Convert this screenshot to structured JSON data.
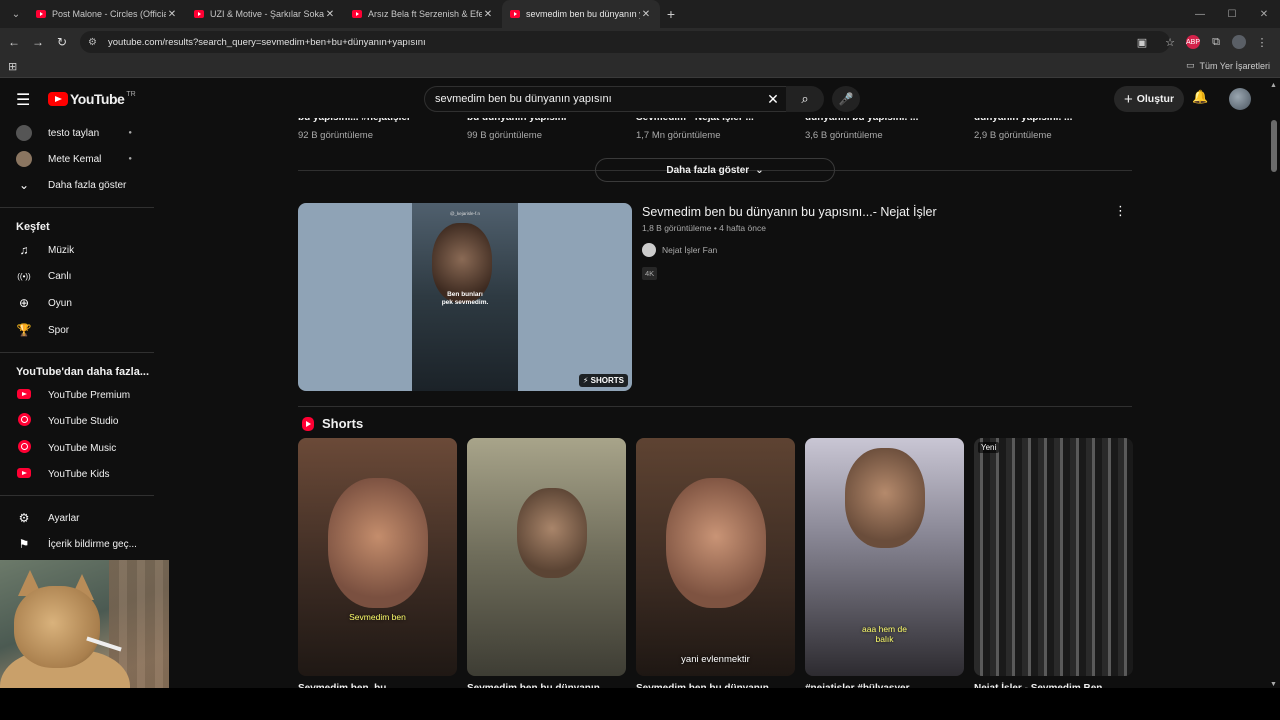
{
  "browser": {
    "tabs": [
      {
        "title": "Post Malone - Circles (Official M",
        "active": false
      },
      {
        "title": "UZI & Motive - Şarkılar Sokakla",
        "active": false
      },
      {
        "title": "Arsız Bela ft Serzenish & Efecan",
        "active": false
      },
      {
        "title": "sevmedim ben bu dünyanın ya",
        "active": true
      }
    ],
    "url": "youtube.com/results?search_query=sevmedim+ben+bu+dünyanın+yapısını",
    "bookmarks_all": "Tüm Yer İşaretleri",
    "icons": {
      "tab_close": "✕",
      "new_tab": "+",
      "back": "←",
      "forward": "→",
      "reload": "↻",
      "minimize": "—",
      "maximize": "☐",
      "close": "✕",
      "menu": "⋮",
      "star": "☆",
      "apps": "⊞",
      "folder": "▭"
    }
  },
  "header": {
    "logo_text": "YouTube",
    "country": "TR",
    "search_value": "sevmedim ben bu dünyanın yapısını",
    "create_label": "Oluştur",
    "icons": {
      "hamburger": "☰",
      "clear": "✕",
      "search": "⌕",
      "mic": "🎙",
      "plus": "+",
      "bell": "🔔"
    }
  },
  "sidebar": {
    "subscriptions": [
      {
        "label": "testo taylan"
      },
      {
        "label": "Mete Kemal"
      }
    ],
    "show_more": "Daha fazla göster",
    "explore_heading": "Keşfet",
    "explore": [
      {
        "label": "Müzik",
        "icon": "♫"
      },
      {
        "label": "Canlı",
        "icon": "((•))"
      },
      {
        "label": "Oyun",
        "icon": "🎮"
      },
      {
        "label": "Spor",
        "icon": "🏆"
      }
    ],
    "more_heading": "YouTube'dan daha fazla...",
    "more": [
      {
        "label": "YouTube Premium"
      },
      {
        "label": "YouTube Studio"
      },
      {
        "label": "YouTube Music"
      },
      {
        "label": "YouTube Kids"
      }
    ],
    "settings": [
      {
        "label": "Ayarlar",
        "icon": "⚙"
      },
      {
        "label": "İçerik bildirme geç...",
        "icon": "⚑"
      }
    ]
  },
  "main": {
    "top_row": [
      {
        "title": "bu yapısını... #nejatişler",
        "views": "92 B görüntüleme"
      },
      {
        "title": "bu dünyanın yapısını",
        "views": "99 B görüntüleme"
      },
      {
        "title": "Sevmedim - Nejat İşler ...",
        "views": "1,7 Mn görüntüleme"
      },
      {
        "title": "dünyanın bu yapısını. ...",
        "views": "3,6 B görüntüleme"
      },
      {
        "title": "dünyanın yapısını. ...",
        "views": "2,9 B görüntüleme"
      }
    ],
    "show_more": "Daha fazla göster",
    "video": {
      "title": "Sevmedim ben bu dünyanın bu yapısını...- Nejat İşler",
      "meta": "1,8 B görüntüleme • 4 hafta önce",
      "channel": "Nejat İşler Fan",
      "badge": "4K",
      "thumb_caption": "Ben bunları\npek sevmedim.",
      "thumb_handle": "@_kejarisle-f.n",
      "shorts_badge": "SHORTS"
    },
    "shorts_heading": "Shorts",
    "shorts": [
      {
        "caption": "Sevmedim ben",
        "title": "Sevmedim ben, bu",
        "new": ""
      },
      {
        "caption": "",
        "title": "Sevmedim ben bu dünyanın",
        "new": ""
      },
      {
        "caption": "yani evlenmektir",
        "title": "Sevmedim ben bu dünyanın",
        "new": ""
      },
      {
        "caption": "aaa hem de\nbalık",
        "title": "#nejatişler #bülvasyer",
        "new": ""
      },
      {
        "caption": "",
        "title": "Nejat İşler - Sevmedim Ben",
        "new": "Yeni"
      }
    ]
  }
}
